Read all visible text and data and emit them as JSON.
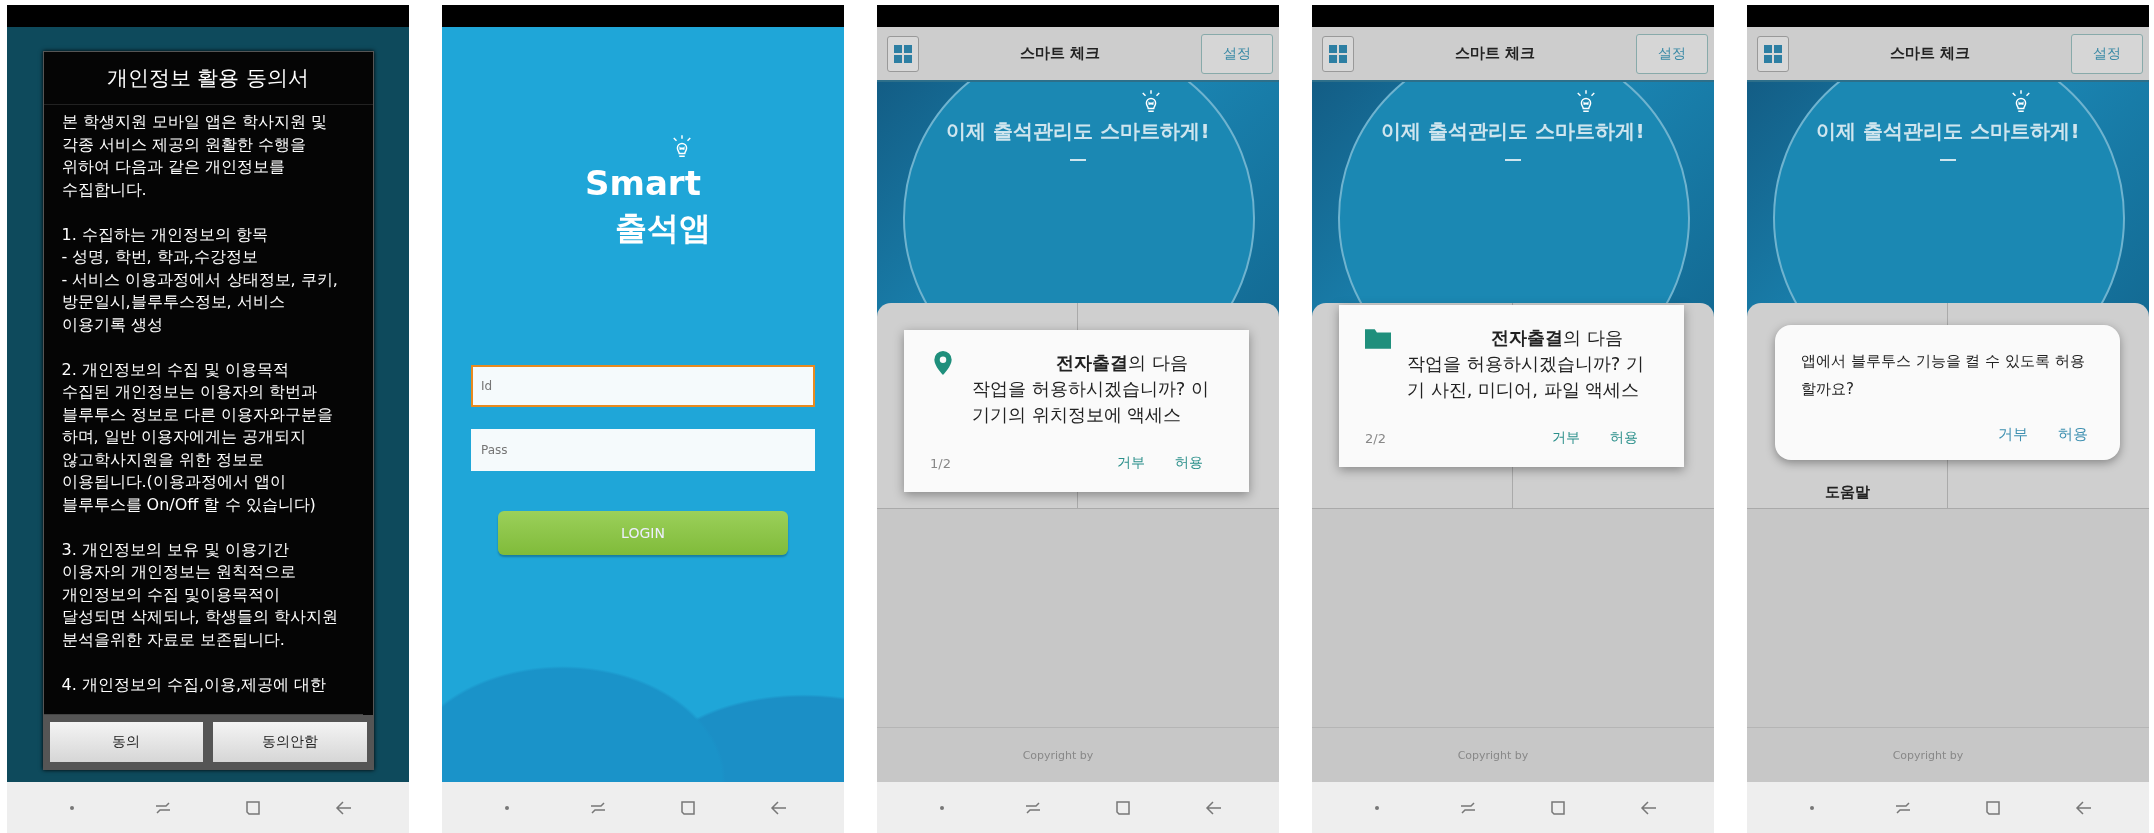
{
  "screens": [
    {
      "kind": "consent",
      "title": "개인정보 활용 동의서",
      "paragraphs": [
        [
          "본 학생지원 모바일 앱은 학사지원 및",
          "각종 서비스 제공의 원활한 수행을",
          "위하여 다음과 같은 개인정보를",
          "수집합니다."
        ],
        [
          "1. 수집하는 개인정보의 항목",
          "- 성명, 학번, 학과,수강정보",
          "- 서비스 이용과정에서 상태정보, 쿠키,",
          "방문일시,블루투스정보, 서비스",
          "이용기록 생성"
        ],
        [
          "2. 개인정보의 수집 및 이용목적",
          "수집된 개인정보는 이용자의 학번과",
          "블루투스 정보로 다른 이용자와구분을",
          "하며, 일반 이용자에게는 공개되지",
          "않고학사지원을 위한 정보로",
          "이용됩니다.(이용과정에서 앱이",
          "블루투스를 On/Off 할 수 있습니다)"
        ],
        [
          "3. 개인정보의 보유 및 이용기간",
          "이용자의 개인정보는 원칙적으로",
          "개인정보의 수집 및이용목적이",
          "달성되면 삭제되나, 학생들의 학사지원",
          "분석을위한 자료로 보존됩니다."
        ],
        [
          "4. 개인정보의 수집,이용,제공에 대한"
        ]
      ],
      "buttons": [
        {
          "label": "동의"
        },
        {
          "label": "동의안함"
        }
      ]
    },
    {
      "kind": "login",
      "logo": {
        "line_1": "Smart",
        "line_2": "출석앱"
      },
      "fields": [
        {
          "placeholder": "Id",
          "focused": true
        },
        {
          "placeholder": "Pass",
          "focused": false
        }
      ],
      "login_button": "LOGIN"
    },
    {
      "kind": "main",
      "header": {
        "title": "스마트 체크",
        "settings_button": "설정"
      },
      "banner": {
        "slogan": "이제 출석관리도 스마트하게!"
      },
      "footer": "Copyright by",
      "dialog": {
        "kind": "location",
        "message": "**전자출결**의 다음 작업을 허용하시겠습니까? 이 기기의 위치정보에 액세스",
        "counter": "1/2",
        "buttons": [
          "거부",
          "허용"
        ]
      }
    },
    {
      "kind": "main",
      "header": {
        "title": "스마트 체크",
        "settings_button": "설정"
      },
      "banner": {
        "slogan": "이제 출석관리도 스마트하게!"
      },
      "footer": "Copyright by",
      "dialog": {
        "kind": "folder",
        "message": "**전자출결**의 다음 작업을 허용하시겠습니까? 기기 사진, 미디어, 파일 액세스",
        "counter": "2/2",
        "buttons": [
          "거부",
          "허용"
        ]
      }
    },
    {
      "kind": "main",
      "header": {
        "title": "스마트 체크",
        "settings_button": "설정"
      },
      "banner": {
        "slogan": "이제 출석관리도 스마트하게!"
      },
      "tiles": [
        {
          "label": "도움말"
        }
      ],
      "footer": "Copyright by",
      "dialog": {
        "kind": "prompt",
        "message": "앱에서 블루투스 기능을 켤 수 있도록 허용할까요?",
        "buttons": [
          "거부",
          "허용"
        ]
      }
    }
  ]
}
